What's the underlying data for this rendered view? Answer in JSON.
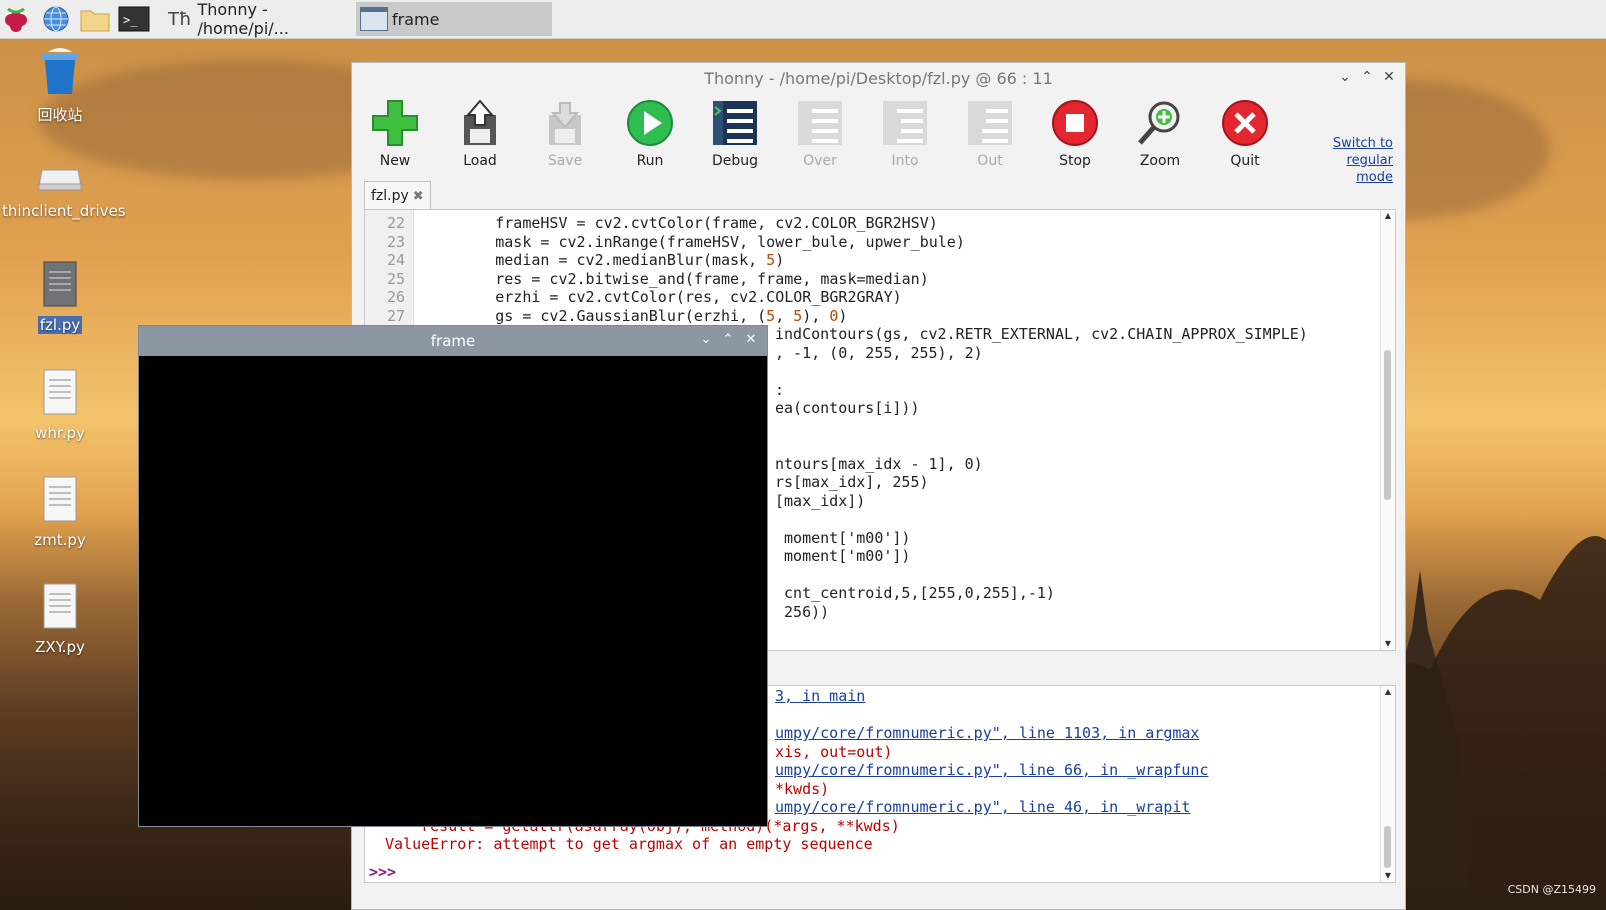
{
  "taskbar": {
    "tasks": [
      {
        "label": "Thonny  -  /home/pi/..."
      },
      {
        "label": "frame"
      }
    ]
  },
  "desktop": {
    "icons": [
      {
        "label": "回收站"
      },
      {
        "label": "thinclient_drives"
      },
      {
        "label": "fzl.py"
      },
      {
        "label": "whr.py"
      },
      {
        "label": "zmt.py"
      },
      {
        "label": "ZXY.py"
      }
    ]
  },
  "thonny": {
    "title": "Thonny  -  /home/pi/Desktop/fzl.py  @  66 : 11",
    "toolbar": [
      {
        "label": "New",
        "enabled": true
      },
      {
        "label": "Load",
        "enabled": true
      },
      {
        "label": "Save",
        "enabled": false
      },
      {
        "label": "Run",
        "enabled": true
      },
      {
        "label": "Debug",
        "enabled": true
      },
      {
        "label": "Over",
        "enabled": false
      },
      {
        "label": "Into",
        "enabled": false
      },
      {
        "label": "Out",
        "enabled": false
      },
      {
        "label": "Stop",
        "enabled": true
      },
      {
        "label": "Zoom",
        "enabled": true
      },
      {
        "label": "Quit",
        "enabled": true
      }
    ],
    "switch_mode": [
      "Switch to",
      "regular",
      "mode"
    ],
    "tab": {
      "label": "fzl.py",
      "close": "✖"
    },
    "editor": {
      "line_numbers": [
        "22",
        "23",
        "24",
        "25",
        "26",
        "27"
      ],
      "lines": [
        "        frameHSV = cv2.cvtColor(frame, cv2.COLOR_BGR2HSV)",
        "        mask = cv2.inRange(frameHSV, lower_bule, upwer_bule)",
        "        median = cv2.medianBlur(mask, ",
        "        res = cv2.bitwise_and(frame, frame, mask=median)",
        "        erzhi = cv2.cvtColor(res, cv2.COLOR_BGR2GRAY)",
        "        gs = cv2.GaussianBlur(erzhi, (",
        "indContours(gs, cv2.RETR_EXTERNAL, cv2.CHAIN_APPROX_SIMPLE)",
        ", -1, (0, 255, 255), 2)",
        ":",
        "ea(contours[i]))",
        "ntours[max_idx - 1], 0)",
        "rs[max_idx], 255)",
        "[max_idx])",
        " moment['m00'])",
        " moment['m00'])",
        " cnt_centroid,5,[255,0,255],-1)",
        " 256))"
      ]
    },
    "shell": {
      "lines": [
        "3, in main",
        "umpy/core/fromnumeric.py\", line 1103, in argmax",
        "xis, out=out)",
        "umpy/core/fromnumeric.py\", line 66, in _wrapfunc",
        "*kwds)",
        "umpy/core/fromnumeric.py\", line 46, in _wrapit",
        "    result = getattr(asarray(obj), method)(*args, **kwds)",
        "ValueError: attempt to get argmax of an empty sequence"
      ],
      "prompt": ">>>"
    }
  },
  "frame_window": {
    "title": "frame"
  },
  "watermark": "CSDN @Z15499",
  "colors": {
    "accent": "#1a3fa3",
    "error": "#c00000",
    "number": "#b34a00",
    "string": "#1e8c1e"
  }
}
